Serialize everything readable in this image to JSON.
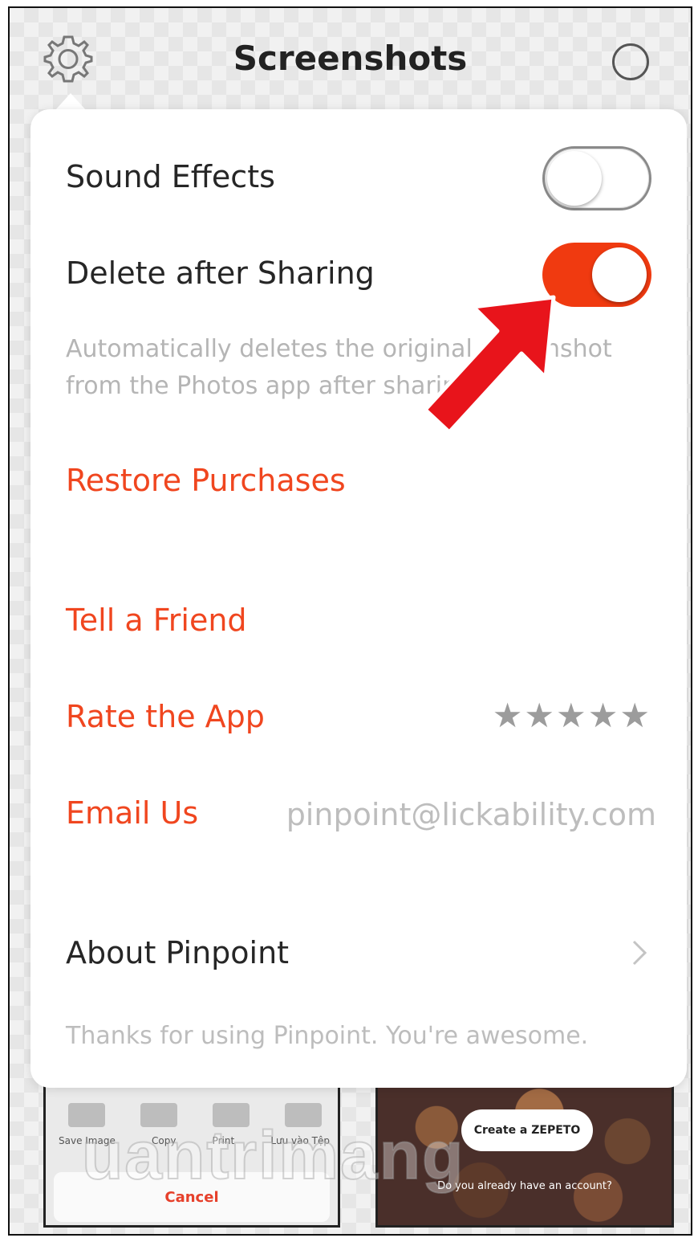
{
  "header": {
    "title": "Screenshots",
    "settings_icon": "gear-icon",
    "select_icon": "circle-icon"
  },
  "settings": {
    "sound_effects": {
      "label": "Sound Effects",
      "enabled": false
    },
    "delete_after_sharing": {
      "label": "Delete after Sharing",
      "enabled": true,
      "description": "Automatically deletes the original screenshot from the Photos app after sharing."
    },
    "restore_purchases": "Restore Purchases",
    "tell_a_friend": "Tell a Friend",
    "rate_the_app": {
      "label": "Rate the App",
      "stars": "★★★★★"
    },
    "email_us": {
      "label": "Email Us",
      "value": "pinpoint@lickability.com"
    },
    "about": "About Pinpoint",
    "thanks": "Thanks for using Pinpoint. You're awesome."
  },
  "thumbnails": {
    "left": {
      "labels": [
        "Save Image",
        "Copy",
        "Print",
        "Lưu vào Tệp"
      ],
      "cancel": "Cancel"
    },
    "right": {
      "button": "Create a ZEPETO",
      "text": "Do you already have an account?"
    }
  },
  "watermark": "uantrimang",
  "colors": {
    "accent": "#f0461f",
    "toggle_on": "#f03a10",
    "annotation_arrow": "#e8141b"
  }
}
